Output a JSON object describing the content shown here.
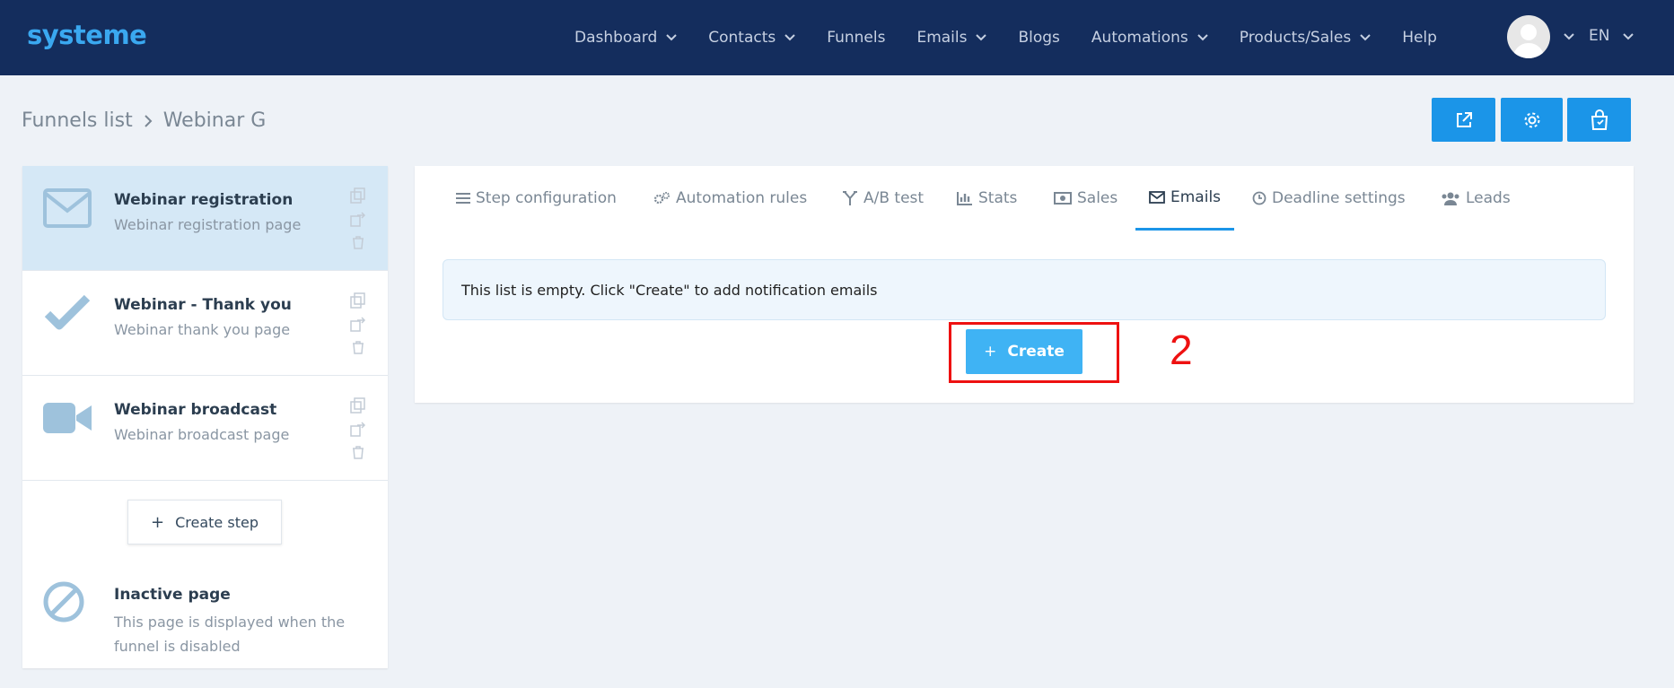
{
  "app": {
    "logo": "systeme"
  },
  "nav": {
    "items": [
      {
        "label": "Dashboard",
        "has_dropdown": true
      },
      {
        "label": "Contacts",
        "has_dropdown": true
      },
      {
        "label": "Funnels",
        "has_dropdown": false
      },
      {
        "label": "Emails",
        "has_dropdown": true
      },
      {
        "label": "Blogs",
        "has_dropdown": false
      },
      {
        "label": "Automations",
        "has_dropdown": true
      },
      {
        "label": "Products/Sales",
        "has_dropdown": true
      },
      {
        "label": "Help",
        "has_dropdown": false
      }
    ],
    "language": "EN"
  },
  "breadcrumb": {
    "root": "Funnels list",
    "current": "Webinar G"
  },
  "toolbar": {
    "buttons": [
      "external-link-icon",
      "gear-icon",
      "shopping-bag-icon"
    ]
  },
  "steps": [
    {
      "title": "Webinar registration",
      "subtitle": "Webinar registration page",
      "icon": "envelope-icon",
      "active": true
    },
    {
      "title": "Webinar - Thank you",
      "subtitle": "Webinar thank you page",
      "icon": "checkmark-icon",
      "active": false
    },
    {
      "title": "Webinar broadcast",
      "subtitle": "Webinar broadcast page",
      "icon": "video-camera-icon",
      "active": false
    }
  ],
  "create_step": {
    "label": "Create step"
  },
  "inactive_page": {
    "title": "Inactive page",
    "subtitle": "This page is displayed when the funnel is disabled"
  },
  "tabs": [
    {
      "label": "Step configuration",
      "icon": "list-icon"
    },
    {
      "label": "Automation rules",
      "icon": "gears-icon"
    },
    {
      "label": "A/B test",
      "icon": "split-icon"
    },
    {
      "label": "Stats",
      "icon": "bar-chart-icon"
    },
    {
      "label": "Sales",
      "icon": "money-icon"
    },
    {
      "label": "Emails",
      "icon": "envelope-icon",
      "active": true
    },
    {
      "label": "Deadline settings",
      "icon": "clock-icon"
    },
    {
      "label": "Leads",
      "icon": "users-icon"
    }
  ],
  "emails": {
    "empty_message": "This list is empty. Click \"Create\" to add notification emails",
    "create_label": "Create"
  },
  "annotation": {
    "number": "2",
    "color": "#ee1111"
  },
  "colors": {
    "header": "#142d5d",
    "accent": "#1b95e8",
    "create_button": "#3fb3f4",
    "active_step": "#d5e8f6"
  }
}
